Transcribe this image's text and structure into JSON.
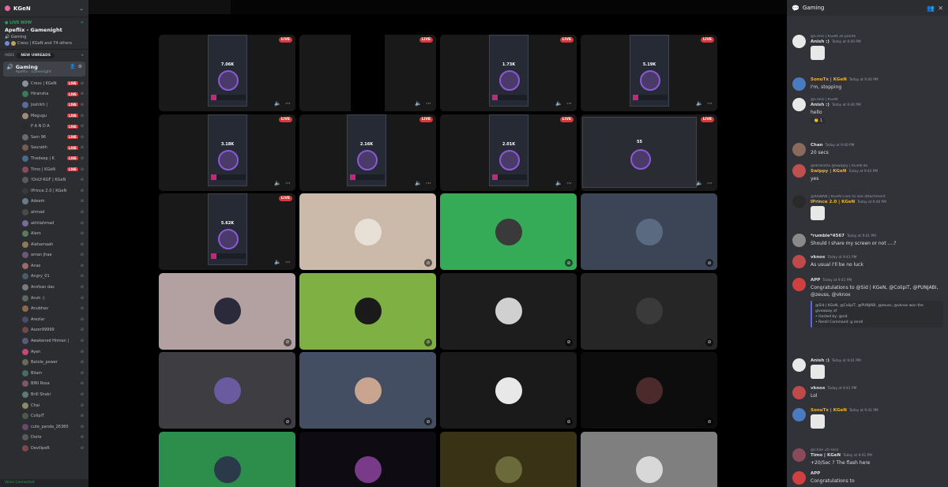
{
  "server": {
    "name": "KGeN"
  },
  "live_now": {
    "label": "LIVE NOW",
    "title": "Apeflix - Gamenight",
    "channel": "Gaming",
    "watchers": "Cress | KGeN and 74 others"
  },
  "category": {
    "label": "INDIE",
    "new_unreads": "NEW UNREADS"
  },
  "voice_channel": {
    "name": "Gaming",
    "desc": "Apeflix - Gamenight"
  },
  "live_badge": "LIVE",
  "users": [
    {
      "name": "Cress | KGeN",
      "live": true,
      "color": "#8a8f98"
    },
    {
      "name": "Hiransha",
      "live": true,
      "color": "#3a7a5a"
    },
    {
      "name": "Joshikh |",
      "live": true,
      "color": "#5a6a9a"
    },
    {
      "name": "Megugu",
      "live": true,
      "color": "#9a8a7a"
    },
    {
      "name": "P A N D A",
      "live": true,
      "color": "#2a2a2a"
    },
    {
      "name": "Sam 96",
      "live": true,
      "color": "#6a6a6a"
    },
    {
      "name": "Saurabh",
      "live": true,
      "color": "#7a5a4a"
    },
    {
      "name": "Thedeep | K",
      "live": true,
      "color": "#4a6a8a"
    },
    {
      "name": "Timo | KGeN",
      "live": true,
      "color": "#8a4a5a"
    },
    {
      "name": "!OnLY-KGF | KGeN",
      "live": false,
      "color": "#5a5a5a"
    },
    {
      "name": "IPrince 2.0 | KGeN",
      "live": false,
      "color": "#3a3a3a"
    },
    {
      "name": "Adeem",
      "live": false,
      "color": "#6a7a8a"
    },
    {
      "name": "ahmad",
      "live": false,
      "color": "#4a4a4a"
    },
    {
      "name": "akhilahmad",
      "live": false,
      "color": "#7a6a9a"
    },
    {
      "name": "Alam",
      "live": false,
      "color": "#5a7a5a"
    },
    {
      "name": "Alahamaah",
      "live": false,
      "color": "#8a7a5a"
    },
    {
      "name": "aman jhaa",
      "live": false,
      "color": "#6a5a7a"
    },
    {
      "name": "Anas",
      "live": false,
      "color": "#9a6a6a"
    },
    {
      "name": "Angry_01",
      "live": false,
      "color": "#4a5a6a"
    },
    {
      "name": "Anirban das",
      "live": false,
      "color": "#7a7a7a"
    },
    {
      "name": "Ansh :)",
      "live": false,
      "color": "#5a6a5a"
    },
    {
      "name": "Anubhav",
      "live": false,
      "color": "#8a6a4a"
    },
    {
      "name": "Arezlar",
      "live": false,
      "color": "#4a4a6a"
    },
    {
      "name": "Aszer99999",
      "live": false,
      "color": "#6a4a4a"
    },
    {
      "name": "Awakened Himian |",
      "live": false,
      "color": "#5a5a7a"
    },
    {
      "name": "Ayan",
      "live": false,
      "color": "#c04a7a"
    },
    {
      "name": "Batola_power",
      "live": false,
      "color": "#6a6a5a"
    },
    {
      "name": "Bilam",
      "live": false,
      "color": "#4a6a6a"
    },
    {
      "name": "BINI Rosa",
      "live": false,
      "color": "#7a5a6a"
    },
    {
      "name": "Brill Shakr",
      "live": false,
      "color": "#5a7a7a"
    },
    {
      "name": "Chai",
      "live": false,
      "color": "#8a8a6a"
    },
    {
      "name": "ColipiT",
      "live": false,
      "color": "#4a5a4a"
    },
    {
      "name": "cute_panda_26380",
      "live": false,
      "color": "#6a4a6a"
    },
    {
      "name": "Dorie",
      "live": false,
      "color": "#5a5a5a"
    },
    {
      "name": "DevilipeR",
      "live": false,
      "color": "#7a4a4a"
    }
  ],
  "voice_connected": "Voice Connected",
  "tiles": [
    {
      "kind": "stream",
      "live": true,
      "stat": "7.06K"
    },
    {
      "kind": "blank",
      "live": true,
      "stat": ""
    },
    {
      "kind": "stream",
      "live": true,
      "stat": "1.73K"
    },
    {
      "kind": "stream",
      "live": true,
      "stat": "5.19K"
    },
    {
      "kind": "stream",
      "live": true,
      "stat": "3.18K"
    },
    {
      "kind": "stream",
      "live": true,
      "stat": "2.16K"
    },
    {
      "kind": "stream",
      "live": true,
      "stat": "2.01K"
    },
    {
      "kind": "desktop",
      "live": true,
      "stat": "55"
    },
    {
      "kind": "stream",
      "live": true,
      "stat": "5.62K"
    },
    {
      "kind": "cam",
      "bg": "#cbb9aa",
      "av": "#e6e0d6"
    },
    {
      "kind": "cam",
      "bg": "#35ab57",
      "av": "#3a3a3a"
    },
    {
      "kind": "cam",
      "bg": "#3b4556",
      "av": "#5a6a80"
    },
    {
      "kind": "cam",
      "bg": "#b3a0a1",
      "av": "#2a2a3a"
    },
    {
      "kind": "cam",
      "bg": "#7fb043",
      "av": "#1a1a1a"
    },
    {
      "kind": "cam",
      "bg": "#1d1d1d",
      "av": "#d0d0d0"
    },
    {
      "kind": "cam",
      "bg": "#262626",
      "av": "#3a3a3a"
    },
    {
      "kind": "cam",
      "bg": "#3e3d42",
      "av": "#6a5aa0"
    },
    {
      "kind": "cam",
      "bg": "#434e62",
      "av": "#c9a590"
    },
    {
      "kind": "cam",
      "bg": "#1a1a1a",
      "av": "#e8e8e8"
    },
    {
      "kind": "cam",
      "bg": "#0d0d0d",
      "av": "#4a2a2a"
    },
    {
      "kind": "cam",
      "bg": "#2c8e4a",
      "av": "#2a3a4a"
    },
    {
      "kind": "cam",
      "bg": "#0e0c12",
      "av": "#7a3a8a"
    },
    {
      "kind": "cam",
      "bg": "#3a3214",
      "av": "#6a6a3a"
    },
    {
      "kind": "cam",
      "bg": "#7f7f7f",
      "av": "#d8d8d8"
    }
  ],
  "chat": {
    "channel": "Gaming",
    "messages": [
      {
        "reply": "@Cress | KGeN 2k points",
        "name": "Anish :)",
        "nameColor": "#dbdee1",
        "time": "Today at 9:40 PM",
        "text": "",
        "image": true,
        "av": "#e8e8e8"
      },
      {
        "reply": "",
        "name": "SonuTx | KGeN",
        "nameColor": "#f0b232",
        "time": "Today at 9:40 PM",
        "text": "I'm, stopping",
        "image": false,
        "av": "#4a7ac0"
      },
      {
        "reply": "@Cress | KGeN",
        "name": "Anish :)",
        "nameColor": "#dbdee1",
        "time": "Today at 9:40 PM",
        "text": "hello",
        "image": false,
        "av": "#e8e8e8",
        "reaction": "1"
      },
      {
        "reply": "",
        "name": "Chan",
        "nameColor": "#dbdee1",
        "time": "Today at 9:40 PM",
        "text": "20 secs",
        "image": false,
        "av": "#8a6a5a"
      },
      {
        "reply": "@Hiransha @Swippy | KGeN da",
        "name": "Swippy | KGeN",
        "nameColor": "#f0b232",
        "time": "Today at 9:40 PM",
        "text": "yes",
        "image": false,
        "av": "#c05050"
      },
      {
        "reply": "@RAWAN | KGeN Click to see attachment",
        "name": "IPrince 2.0 | KGeN",
        "nameColor": "#f0b232",
        "time": "Today at 9:40 PM",
        "text": "",
        "image": true,
        "av": "#2a2a2a"
      },
      {
        "reply": "",
        "name": "*rumble*4567",
        "nameColor": "#dbdee1",
        "time": "Today at 9:41 PM",
        "text": "Should I share my screen or not ....?",
        "image": false,
        "av": "#8a8a8a"
      },
      {
        "reply": "",
        "name": "vknox",
        "nameColor": "#dbdee1",
        "time": "Today at 9:41 PM",
        "text": "As usual I'll be no luck",
        "image": false,
        "av": "#c04a4a"
      },
      {
        "reply": "",
        "name": "APP",
        "nameColor": "#dbdee1",
        "time": "Today at 9:41 PM",
        "text": "Congratulations to @Sid | KGeN, @ColipiT, @PUNJABI, @zeuss, @vknox",
        "image": false,
        "av": "#d04040",
        "embed": [
          "@Sid | KGeN, @ColipiT, @PUNJABI, @zeuss, @vknox won the giveaway of",
          "• Hosted by: @sid",
          "• Reroll Command: g.reroll"
        ]
      },
      {
        "reply": "",
        "name": "Anish :)",
        "nameColor": "#dbdee1",
        "time": "Today at 9:41 PM",
        "text": "",
        "image": true,
        "av": "#e8e8e8"
      },
      {
        "reply": "",
        "name": "vknox",
        "nameColor": "#dbdee1",
        "time": "Today at 9:41 PM",
        "text": "Lol",
        "image": false,
        "av": "#c04a4a"
      },
      {
        "reply": "",
        "name": "SonuTx | KGeN",
        "nameColor": "#f0b232",
        "time": "Today at 9:41 PM",
        "text": "",
        "image": true,
        "av": "#4a7ac0"
      },
      {
        "reply": "@Chan 20 secs",
        "name": "Timo | KGeN",
        "nameColor": "#dbdee1",
        "time": "Today at 9:41 PM",
        "text": "+20/Sec ? The flash here",
        "image": false,
        "av": "#8a4a5a"
      },
      {
        "reply": "",
        "name": "APP",
        "nameColor": "#dbdee1",
        "time": "",
        "text": "Congratulations to",
        "image": false,
        "av": "#d04040"
      }
    ]
  }
}
